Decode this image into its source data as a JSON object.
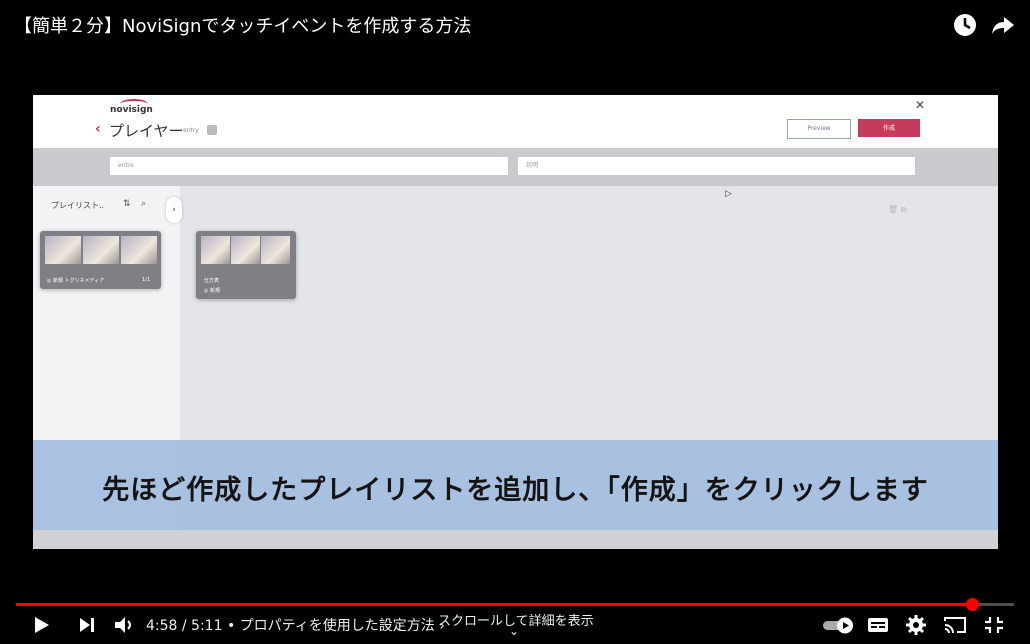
{
  "video": {
    "title": "【簡単２分】NoviSignでタッチイベントを作成する方法",
    "caption": "先ほど作成したプレイリストを追加し、「作成」をクリックします"
  },
  "app": {
    "logo": "novisign",
    "page_title": "プレイヤー",
    "subtitle": "entry",
    "preview_label": "Preview",
    "create_label": "作成",
    "name_field_value": "entre",
    "search_placeholder": "説明",
    "sidebar_title": "プレイリスト..",
    "playlist_card_left": {
      "name": "",
      "meta": "◎ 新規  トグリネメディア",
      "count": "1/1"
    },
    "playlist_card_right": {
      "name": "仕方表",
      "meta": "◎ 新規"
    }
  },
  "player": {
    "current_time": "4:58",
    "duration": "5:11",
    "chapter": "プロパティを使用した設定方法",
    "time_display": "4:58 / 5:11 • プロパティを使用した設定方法 ›",
    "scroll_hint": "スクロールして詳細を表示",
    "progress_fraction": 0.958
  },
  "colors": {
    "accent": "#c63a5a",
    "progress": "#ff0000",
    "caption_band": "#a4bede"
  }
}
